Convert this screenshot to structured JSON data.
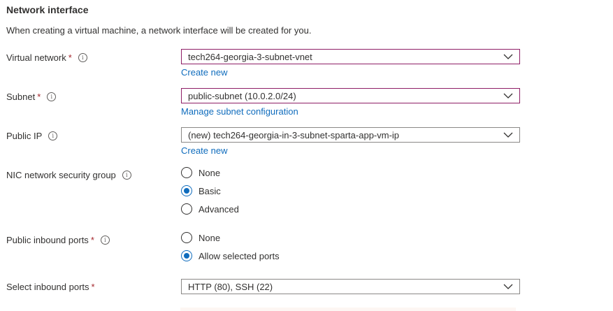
{
  "section": {
    "title": "Network interface",
    "description": "When creating a virtual machine, a network interface will be created for you."
  },
  "fields": {
    "virtual_network": {
      "label": "Virtual network",
      "required_mark": "*",
      "value": "tech264-georgia-3-subnet-vnet",
      "link": "Create new"
    },
    "subnet": {
      "label": "Subnet",
      "required_mark": "*",
      "value": "public-subnet (10.0.2.0/24)",
      "link": "Manage subnet configuration"
    },
    "public_ip": {
      "label": "Public IP",
      "value": "(new) tech264-georgia-in-3-subnet-sparta-app-vm-ip",
      "link": "Create new"
    },
    "nic_nsg": {
      "label": "NIC network security group",
      "options": [
        "None",
        "Basic",
        "Advanced"
      ],
      "selected": "Basic"
    },
    "public_inbound_ports": {
      "label": "Public inbound ports",
      "required_mark": "*",
      "options": [
        "None",
        "Allow selected ports"
      ],
      "selected": "Allow selected ports"
    },
    "select_inbound_ports": {
      "label": "Select inbound ports",
      "required_mark": "*",
      "value": "HTTP (80), SSH (22)"
    }
  },
  "info_glyph": "i",
  "icons": {
    "info": "info-icon",
    "dropdown": "chevron-down-icon"
  },
  "colors": {
    "link": "#0f6cbd",
    "required": "#a4262c",
    "invalid_border": "#8e1e66",
    "radio_selected": "#0f6cbd"
  }
}
